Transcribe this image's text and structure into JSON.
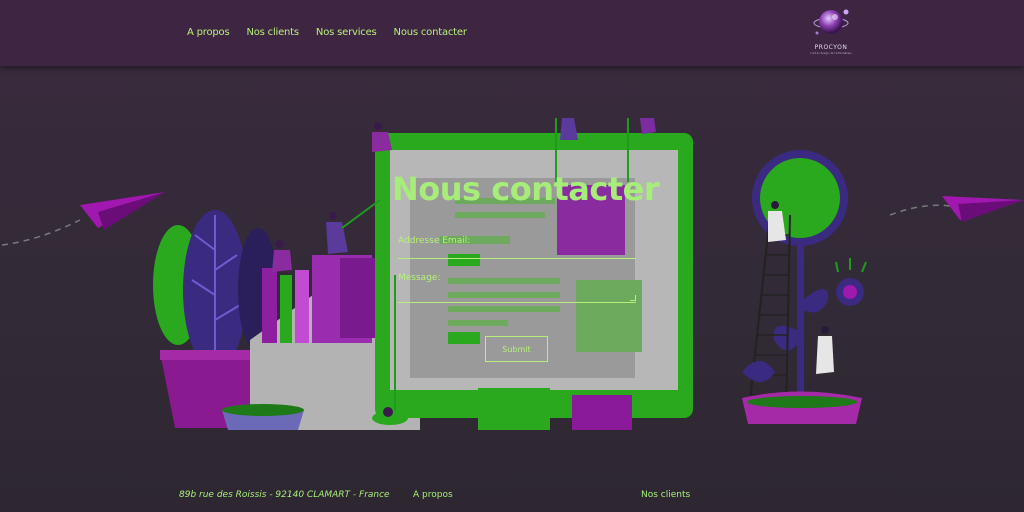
{
  "nav": {
    "items": [
      {
        "label": "A propos"
      },
      {
        "label": "Nos clients"
      },
      {
        "label": "Nos services"
      },
      {
        "label": "Nous contacter"
      }
    ]
  },
  "logo": {
    "name": "PROCYON",
    "tagline": "L'art du design, de l'informatique"
  },
  "contact_form": {
    "title": "Nous contacter",
    "email_label": "Addresse Email:",
    "email_value": "",
    "message_label": "Message:",
    "message_value": "",
    "submit_label": "Submit"
  },
  "footer": {
    "address": "89b rue des Roissis - 92140 CLAMART - France",
    "link_about": "A propos",
    "link_clients": "Nos clients"
  },
  "colors": {
    "accent_green": "#a6ed7a",
    "header_bg": "#3e2541",
    "page_bg": "#322a36",
    "illustration_purple": "#8a1a9a",
    "illustration_green": "#1f9c1c"
  }
}
